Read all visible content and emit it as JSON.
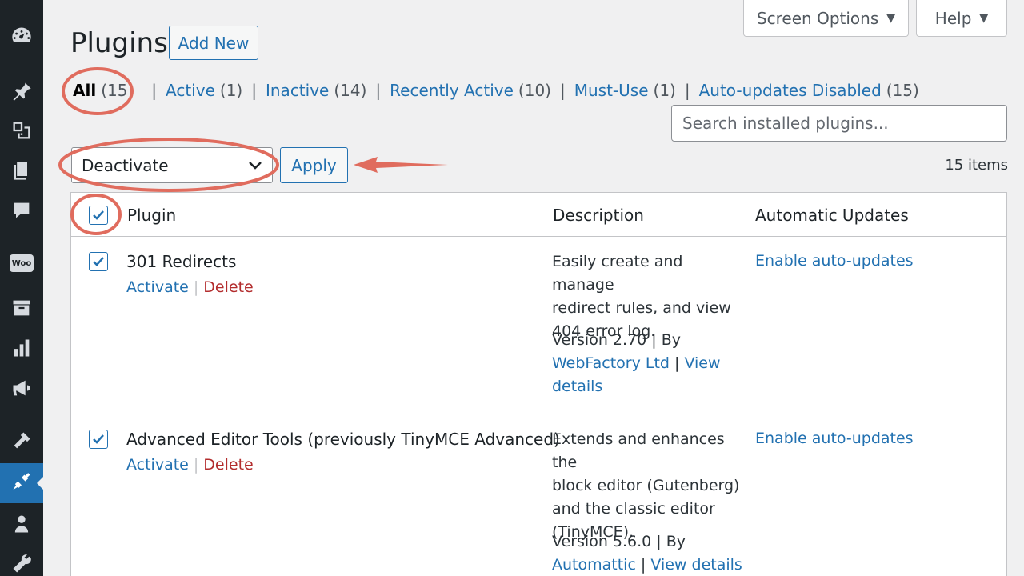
{
  "header": {
    "title": "Plugins",
    "add_new": "Add New",
    "screen_options": "Screen Options",
    "help": "Help",
    "caret": "▼"
  },
  "filters": {
    "all": {
      "label": "All",
      "count": "(15)"
    },
    "active": {
      "label": "Active",
      "count": "(1)"
    },
    "inactive": {
      "label": "Inactive",
      "count": "(14)"
    },
    "recently_active": {
      "label": "Recently Active",
      "count": "(10)"
    },
    "must_use": {
      "label": "Must-Use",
      "count": "(1)"
    },
    "auto_disabled": {
      "label": "Auto-updates Disabled",
      "count": "(15)"
    },
    "separator": "|"
  },
  "search": {
    "placeholder": "Search installed plugins..."
  },
  "bulk": {
    "selected": "Deactivate",
    "apply": "Apply",
    "items_count": "15 items"
  },
  "table": {
    "columns": {
      "plugin": "Plugin",
      "description": "Description",
      "auto_updates": "Automatic Updates"
    },
    "rows": [
      {
        "name": "301 Redirects",
        "activate": "Activate",
        "delete": "Delete",
        "description": [
          "Easily create and manage",
          "redirect rules, and view",
          "404 error log."
        ],
        "version": "Version 2.70 | By",
        "author": "WebFactory Ltd",
        "view": "View",
        "details": "details",
        "auto": "Enable auto-updates"
      },
      {
        "name": "Advanced Editor Tools (previously TinyMCE Advanced)",
        "activate": "Activate",
        "delete": "Delete",
        "description": [
          "Extends and enhances the",
          "block editor (Gutenberg)",
          "and the classic editor",
          "(TinyMCE)."
        ],
        "version": "Version 5.6.0 | By",
        "author": "Automattic",
        "view_details": "View details",
        "auto": "Enable auto-updates"
      }
    ]
  },
  "colors": {
    "accent": "#2271b1",
    "sidebar": "#1d2327",
    "annotation": "#e06c5e",
    "delete": "#b32d2e"
  }
}
